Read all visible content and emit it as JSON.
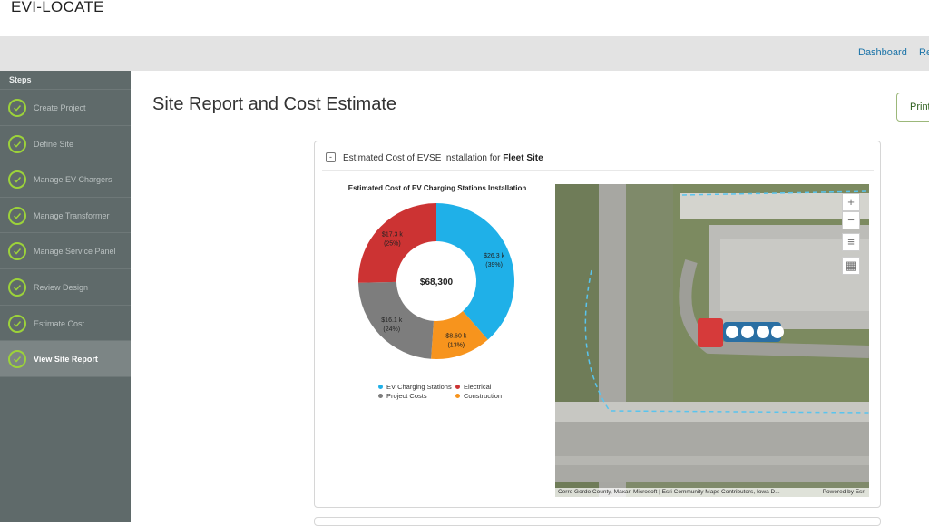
{
  "app": {
    "title": "EVI-LOCATE"
  },
  "nav": {
    "links": [
      "Dashboard",
      "Re"
    ]
  },
  "sidebar": {
    "title": "Steps",
    "items": [
      {
        "label": "Create Project",
        "active": false
      },
      {
        "label": "Define Site",
        "active": false
      },
      {
        "label": "Manage EV Chargers",
        "active": false
      },
      {
        "label": "Manage Transformer",
        "active": false
      },
      {
        "label": "Manage Service Panel",
        "active": false
      },
      {
        "label": "Review Design",
        "active": false
      },
      {
        "label": "Estimate Cost",
        "active": false
      },
      {
        "label": "View Site Report",
        "active": true
      }
    ]
  },
  "page": {
    "title": "Site Report and Cost Estimate",
    "print_label": "Print"
  },
  "card": {
    "collapse_symbol": "-",
    "title_prefix": "Estimated Cost of EVSE Installation for ",
    "title_bold": "Fleet Site"
  },
  "chart_data": {
    "type": "pie",
    "title": "Estimated Cost of EV Charging Stations Installation",
    "center_label": "$68,300",
    "slices": [
      {
        "name": "EV Charging Stations",
        "value": 26.3,
        "label": "$26.3 k",
        "percent": "(39%)",
        "color": "#1fb0e8"
      },
      {
        "name": "Construction",
        "value": 8.6,
        "label": "$8.60 k",
        "percent": "(13%)",
        "color": "#f7941d"
      },
      {
        "name": "Project Costs",
        "value": 16.1,
        "label": "$16.1 k",
        "percent": "(24%)",
        "color": "#7d7d7d"
      },
      {
        "name": "Electrical",
        "value": 17.3,
        "label": "$17.3 k",
        "percent": "(25%)",
        "color": "#cc3333"
      }
    ],
    "legend": [
      "EV Charging Stations",
      "Electrical",
      "Project Costs",
      "Construction"
    ]
  },
  "map": {
    "zoom_in": "+",
    "zoom_out": "−",
    "attribution": "Cerro Gordo County, Maxar, Microsoft | Esri Community Maps Contributors, Iowa D...",
    "powered_by": "Powered by Esri"
  },
  "icons": {
    "check": "check-icon",
    "menu": "menu-icon",
    "qr": "qr-icon"
  },
  "colors": {
    "accent": "#9cd23a",
    "sidebar": "#5f6a6a",
    "link": "#1a73a8"
  }
}
